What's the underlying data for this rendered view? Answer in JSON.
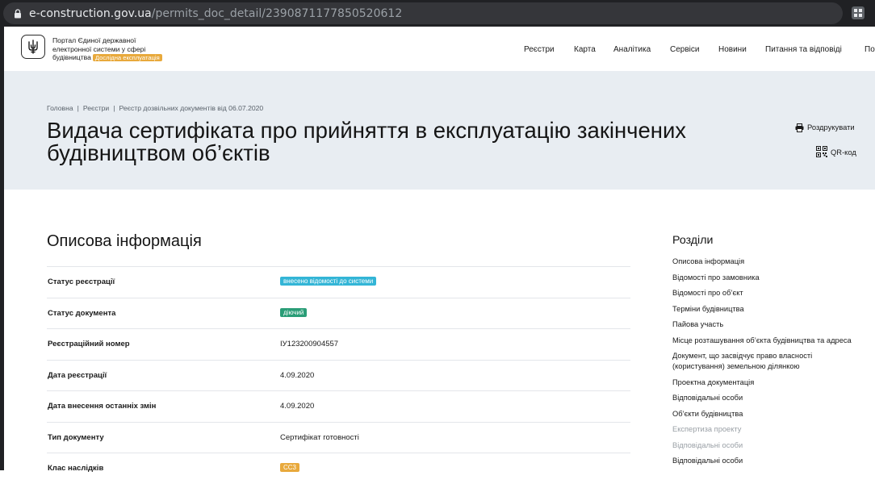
{
  "browser": {
    "url_host": "e-construction.gov.ua",
    "url_path": "/permits_doc_detail/2390871177850520612"
  },
  "header": {
    "brand_line1": "Портал Єдиної державної",
    "brand_line2": "електронної системи у сфері",
    "brand_line3": "будівництва",
    "badge": "Дослідна експлуатація",
    "nav": [
      "Реєстри",
      "Карта",
      "Аналітика",
      "Сервіси",
      "Новини",
      "Питання та відповіді",
      "По"
    ]
  },
  "breadcrumbs": [
    "Головна",
    "Реєстри",
    "Реєстр дозвільних документів від 06.07.2020"
  ],
  "page_title": "Видача сертифіката про прийняття в експлуатацію закінчених будівництвом об’єктів",
  "actions": {
    "print": "Роздрукувати",
    "qr": "QR-код"
  },
  "section_title": "Описова інформація",
  "details": [
    {
      "label": "Статус реєстрації",
      "value": "внесено відомості до системи",
      "tag_color": "#33b5d6"
    },
    {
      "label": "Статус документа",
      "value": "діючий",
      "tag_color": "#2a9d77"
    },
    {
      "label": "Реєстраційний номер",
      "value": "ІУ123200904557"
    },
    {
      "label": "Дата реєстрації",
      "value": "4.09.2020"
    },
    {
      "label": "Дата внесення останніх змін",
      "value": "4.09.2020"
    },
    {
      "label": "Тип документу",
      "value": "Сертифікат готовності"
    },
    {
      "label": "Клас наслідків",
      "value": "СС3",
      "tag_color": "#e8a93c"
    }
  ],
  "sidebar": {
    "title": "Розділи",
    "items": [
      "Описова інформація",
      "Відомості про замовника",
      "Відомості про об’єкт",
      "Терміни будівництва",
      "Пайова участь",
      "Місце розташування об’єкта будівництва та адреса",
      "Документ, що засвідчує право власності (користування) земельною ділянкою",
      "Проектна документація",
      "Відповідальні особи",
      "Об’єкти будівництва",
      "Експертиза проекту",
      "Відповідальні особи",
      "Відповідальні особи"
    ],
    "dimmed": [
      10,
      11
    ]
  },
  "colors": {
    "hero_bg": "#e8edf2",
    "accent_blue": "#33b5d6",
    "accent_green": "#2a9d77",
    "accent_orange": "#e8a93c"
  },
  "icons": [
    "lock-icon",
    "extension-icon",
    "trident-logo-icon",
    "printer-icon",
    "qr-code-icon"
  ]
}
